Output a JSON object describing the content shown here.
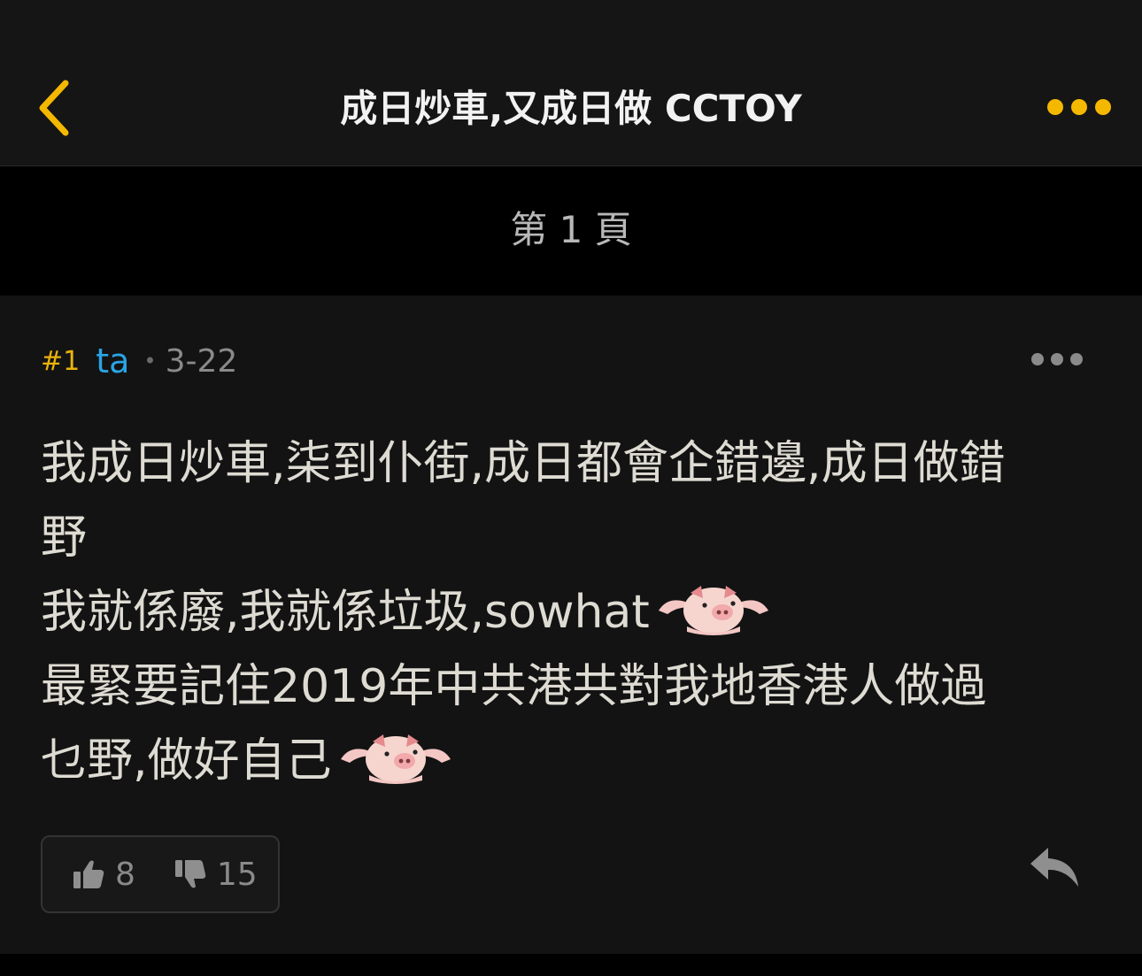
{
  "header": {
    "title": "成日炒車,又成日做 CCTOY",
    "back_icon": "chevron-left-icon",
    "more_icon": "more-horizontal-icon"
  },
  "page_bar": {
    "label": "第 1 頁"
  },
  "post": {
    "floor": "#1",
    "username": "ta",
    "separator": "•",
    "date": "3-22",
    "more_icon": "more-horizontal-icon",
    "lines": [
      "我成日炒車,柒到仆街,成日都會企錯邊,成日做錯",
      "野",
      "我就係廢,我就係垃圾,sowhat",
      "最緊要記住2019年中共港共對我地香港人做過",
      "乜野,做好自己"
    ],
    "emoji": "pig-emoji-icon",
    "likes": "8",
    "dislikes": "15",
    "reply_icon": "reply-icon"
  },
  "colors": {
    "accent": "#f5b800",
    "username": "#2aa4e5",
    "background": "#131313",
    "header_bg": "#151515",
    "text": "#dedbd3"
  }
}
